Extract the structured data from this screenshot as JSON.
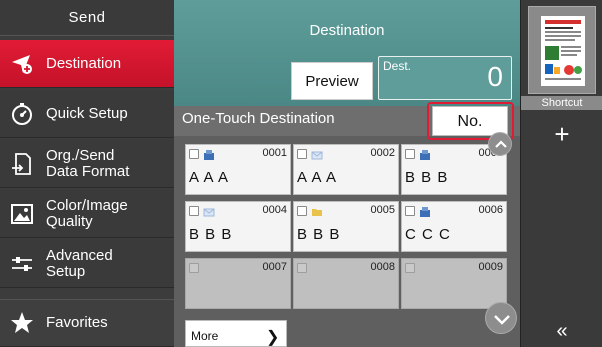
{
  "sidebar": {
    "title": "Send",
    "items": [
      {
        "label": "Destination",
        "icon": "destination-icon",
        "active": true
      },
      {
        "label": "Quick Setup",
        "icon": "quick-setup-icon",
        "active": false
      },
      {
        "label": "Org./Send\nData Format",
        "icon": "data-format-icon",
        "active": false
      },
      {
        "label": "Color/Image\nQuality",
        "icon": "image-quality-icon",
        "active": false
      },
      {
        "label": "Advanced\nSetup",
        "icon": "advanced-setup-icon",
        "active": false
      }
    ],
    "favorites_label": "Favorites"
  },
  "main": {
    "title": "Destination",
    "preview_label": "Preview",
    "dest_label": "Dest.",
    "dest_count": "0",
    "section_label": "One-Touch Destination",
    "sort_label": "No.",
    "more_label": "More",
    "tiles": [
      {
        "number": "0001",
        "name": "A A A",
        "type": "fax",
        "empty": false
      },
      {
        "number": "0002",
        "name": "A A A",
        "type": "email",
        "empty": false
      },
      {
        "number": "0003",
        "name": "B B B",
        "type": "fax",
        "empty": false
      },
      {
        "number": "0004",
        "name": "B B B",
        "type": "email",
        "empty": false
      },
      {
        "number": "0005",
        "name": "B B B",
        "type": "folder",
        "empty": false
      },
      {
        "number": "0006",
        "name": "C C C",
        "type": "fax",
        "empty": false
      },
      {
        "number": "0007",
        "name": "",
        "type": "",
        "empty": true
      },
      {
        "number": "0008",
        "name": "",
        "type": "",
        "empty": true
      },
      {
        "number": "0009",
        "name": "",
        "type": "",
        "empty": true
      }
    ]
  },
  "right": {
    "shortcut_label": "Shortcut",
    "add_symbol": "+",
    "collapse_symbol": "«"
  },
  "colors": {
    "accent_red": "#e21b35",
    "teal": "#5e9d9a",
    "dark": "#3a3a3a"
  }
}
